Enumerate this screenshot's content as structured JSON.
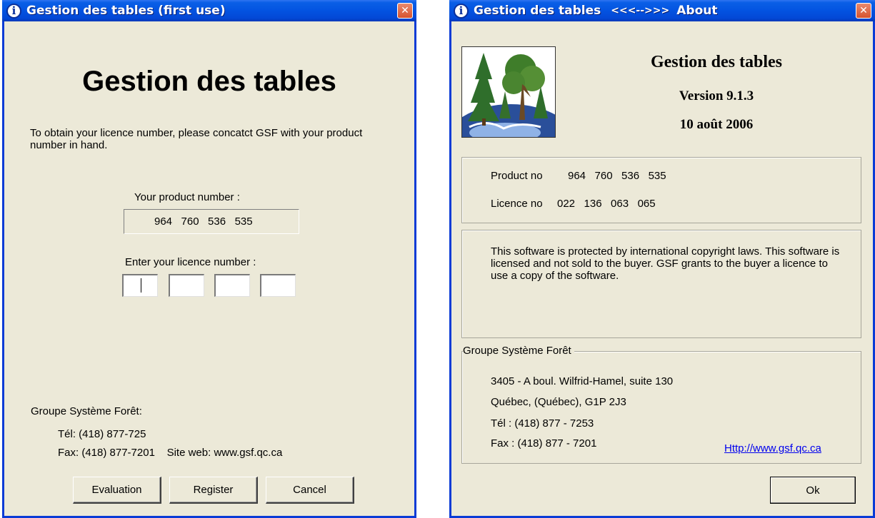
{
  "left_window": {
    "title": "Gestion des tables (first use)",
    "heading": "Gestion des tables",
    "instructions": "To obtain your licence number, please concatct GSF with your product number in hand.",
    "product_label": "Your product number :",
    "product_number": "964   760   536   535",
    "licence_label": "Enter your licence number :",
    "licence_fields": [
      "",
      "",
      "",
      ""
    ],
    "company": "Groupe Système Forêt:",
    "tel": "Tél: (418) 877-725",
    "fax_site": "Fax: (418) 877-7201    Site web: www.gsf.qc.ca",
    "buttons": {
      "evaluation": "Evaluation",
      "register": "Register",
      "cancel": "Cancel"
    }
  },
  "right_window": {
    "title": "Gestion des tables",
    "title_nav": "<<<-->>>",
    "title_about": "About",
    "app_name": "Gestion des tables",
    "version": "Version 9.1.3",
    "date": "10 août 2006",
    "product_label": "Product no",
    "product_value": "964   760   536   535",
    "licence_label": "Licence no",
    "licence_value": "022   136   063   065",
    "copyright": "This software is protected by international copyright laws. This software is licensed and not sold to the buyer. GSF grants to the buyer a licence to use a copy of the software.",
    "group_title": "Groupe Système Forêt",
    "address1": "3405 - A boul. Wilfrid-Hamel, suite 130",
    "address2": "Québec, (Québec), G1P 2J3",
    "tel": "Tél : (418) 877 - 7253",
    "fax": "Fax : (418) 877 - 7201",
    "url": "Http://www.gsf.qc.ca",
    "ok": "Ok"
  },
  "icons": {
    "title_icon": "info-icon",
    "close": "close-icon",
    "logo": "tree-globe-logo-icon"
  },
  "colors": {
    "titlebar": "#0353e1",
    "window_bg": "#ece9d8",
    "close": "#d6532f",
    "link": "#0000ee"
  }
}
